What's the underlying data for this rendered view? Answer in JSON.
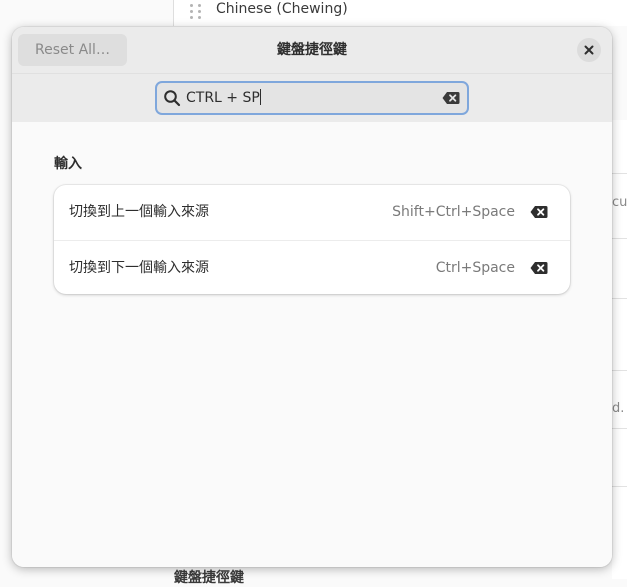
{
  "background": {
    "top_item_label": "Chinese (Chewing)",
    "right_fragments": [
      "cut",
      "d."
    ],
    "bottom_label": "鍵盤捷徑鍵"
  },
  "dialog": {
    "title": "鍵盤捷徑鍵",
    "reset_label": "Reset All…",
    "close_icon": "close-icon"
  },
  "search": {
    "value": "CTRL + SP",
    "icon": "search-icon",
    "clear_icon": "clear-icon"
  },
  "section": {
    "title": "輸入",
    "rows": [
      {
        "label": "切換到上一個輸入來源",
        "accel": "Shift+Ctrl+Space"
      },
      {
        "label": "切換到下一個輸入來源",
        "accel": "Ctrl+Space"
      }
    ]
  },
  "colors": {
    "accent_focus": "#7fa7dc",
    "headerbar": "#ebebeb",
    "card": "#ffffff"
  }
}
